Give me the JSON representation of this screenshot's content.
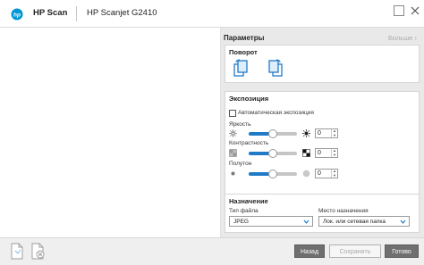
{
  "app": {
    "brand": "HP Scan",
    "device": "HP Scanjet G2410",
    "brand_color": "#0096d6"
  },
  "panel": {
    "title": "Параметры",
    "more": "Больше"
  },
  "rotation": {
    "title": "Поворот",
    "rotate_left_icon": "rotate-left-icon",
    "rotate_right_icon": "rotate-right-icon"
  },
  "exposure": {
    "title": "Экспозиция",
    "auto_label": "Автоматическая экспозиция",
    "auto_checked": false,
    "brightness": {
      "label": "Яркость",
      "value": "0",
      "level": 50
    },
    "contrast": {
      "label": "Контрастность",
      "value": "0",
      "level": 50
    },
    "halftone": {
      "label": "Полутон",
      "value": "0",
      "level": 50
    }
  },
  "destination": {
    "title": "Назначение",
    "file_type_label": "Тип файла",
    "file_type_value": "JPEG",
    "location_label": "Место назначения",
    "location_value": "Лок. или сетевая папка"
  },
  "buttons": {
    "back": "Назад",
    "save": "Сохранить",
    "done": "Готово"
  },
  "colors": {
    "accent": "#1f7ac8",
    "panel_bg": "#e9e9e9",
    "dark_button": "#6f6f6f"
  }
}
